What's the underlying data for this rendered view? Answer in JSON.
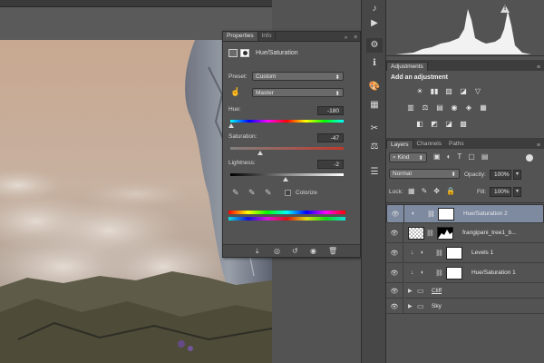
{
  "properties": {
    "tabs": [
      "Properties",
      "Info"
    ],
    "title": "Hue/Saturation",
    "preset_label": "Preset:",
    "preset_value": "Custom",
    "channel_value": "Master",
    "hue_label": "Hue:",
    "hue_value": "-180",
    "saturation_label": "Saturation:",
    "saturation_value": "-47",
    "lightness_label": "Lightness:",
    "lightness_value": "-2",
    "colorize_label": "Colorize",
    "menu_glyph": "»"
  },
  "adjustments": {
    "tab": "Adjustments",
    "header": "Add an adjustment",
    "row1": [
      "☀",
      "▮▮",
      "▨",
      "◪",
      "▽"
    ],
    "row2": [
      "▥",
      "⚖",
      "▤",
      "◉",
      "◈",
      "▦"
    ],
    "row3": [
      "◧",
      "◩",
      "◪",
      "▩"
    ]
  },
  "layers_panel": {
    "tabs": [
      "Layers",
      "Channels",
      "Paths"
    ],
    "filter_value": "Kind",
    "blend_value": "Normal",
    "opacity_label": "Opacity:",
    "opacity_value": "100%",
    "lock_label": "Lock:",
    "fill_label": "Fill:",
    "fill_value": "100%",
    "layers": [
      {
        "name": "Hue/Saturation 2",
        "type": "adjustment",
        "selected": true
      },
      {
        "name": "frangipani_tree1_b...",
        "type": "image",
        "selected": false
      },
      {
        "name": "Levels 1",
        "type": "adjustment",
        "selected": false
      },
      {
        "name": "Hue/Saturation 1",
        "type": "adjustment",
        "selected": false
      },
      {
        "name": "Cliff",
        "type": "group",
        "selected": false
      },
      {
        "name": "Sky",
        "type": "group",
        "selected": false
      }
    ]
  },
  "histogram": {
    "warning_icon": "!"
  },
  "tools": [
    "♪",
    "▶",
    "⚙",
    "ℹ",
    "🎨",
    "▦",
    "✂",
    "⚖",
    "☰"
  ],
  "colors": {
    "panel": "#535353",
    "dark": "#3d3d3d",
    "selected_layer": "#7d8aa0",
    "accent_blue": "#5b8dd6"
  }
}
